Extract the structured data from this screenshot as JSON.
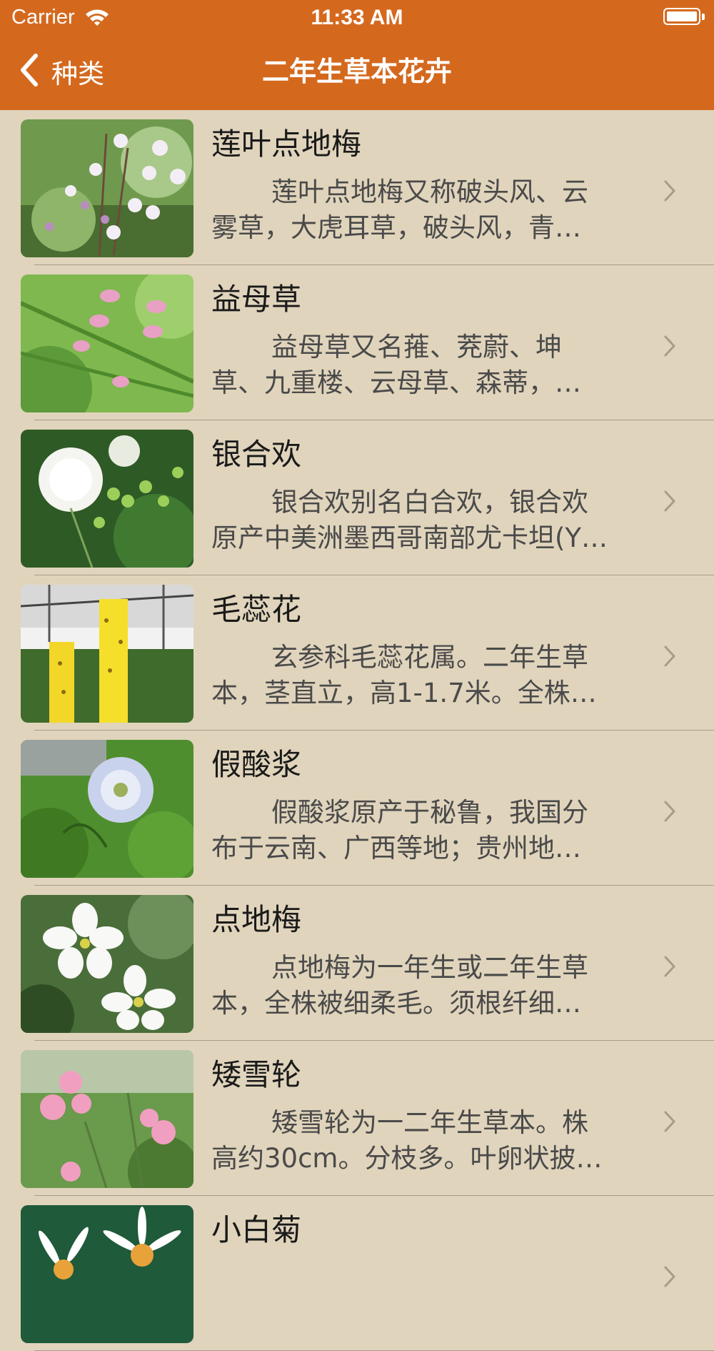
{
  "status_bar": {
    "carrier": "Carrier",
    "time": "11:33 AM"
  },
  "nav": {
    "back_label": "种类",
    "title": "二年生草本花卉"
  },
  "rows": [
    {
      "title": "莲叶点地梅",
      "desc_line1": "莲叶点地梅又称破头风、云",
      "desc_line2": "雾草，大虎耳草，破头风，青…"
    },
    {
      "title": "益母草",
      "desc_line1": "益母草又名蓷、茺蔚、坤",
      "desc_line2": "草、九重楼、云母草、森蒂，…"
    },
    {
      "title": "银合欢",
      "desc_line1": "银合欢别名白合欢，银合欢",
      "desc_line2": "原产中美洲墨西哥南部尤卡坦(Y…"
    },
    {
      "title": "毛蕊花",
      "desc_line1": "玄参科毛蕊花属。二年生草",
      "desc_line2": "本，茎直立，高1-1.7米。全株…"
    },
    {
      "title": "假酸浆",
      "desc_line1": "假酸浆原产于秘鲁，我国分",
      "desc_line2": "布于云南、广西等地；贵州地…"
    },
    {
      "title": "点地梅",
      "desc_line1": "点地梅为一年生或二年生草",
      "desc_line2": "本，全株被细柔毛。须根纤细…"
    },
    {
      "title": "矮雪轮",
      "desc_line1": "矮雪轮为一二年生草本。株",
      "desc_line2": "高约30cm。分枝多。叶卵状披…"
    },
    {
      "title": "小白菊",
      "desc_line1": "",
      "desc_line2": ""
    }
  ]
}
